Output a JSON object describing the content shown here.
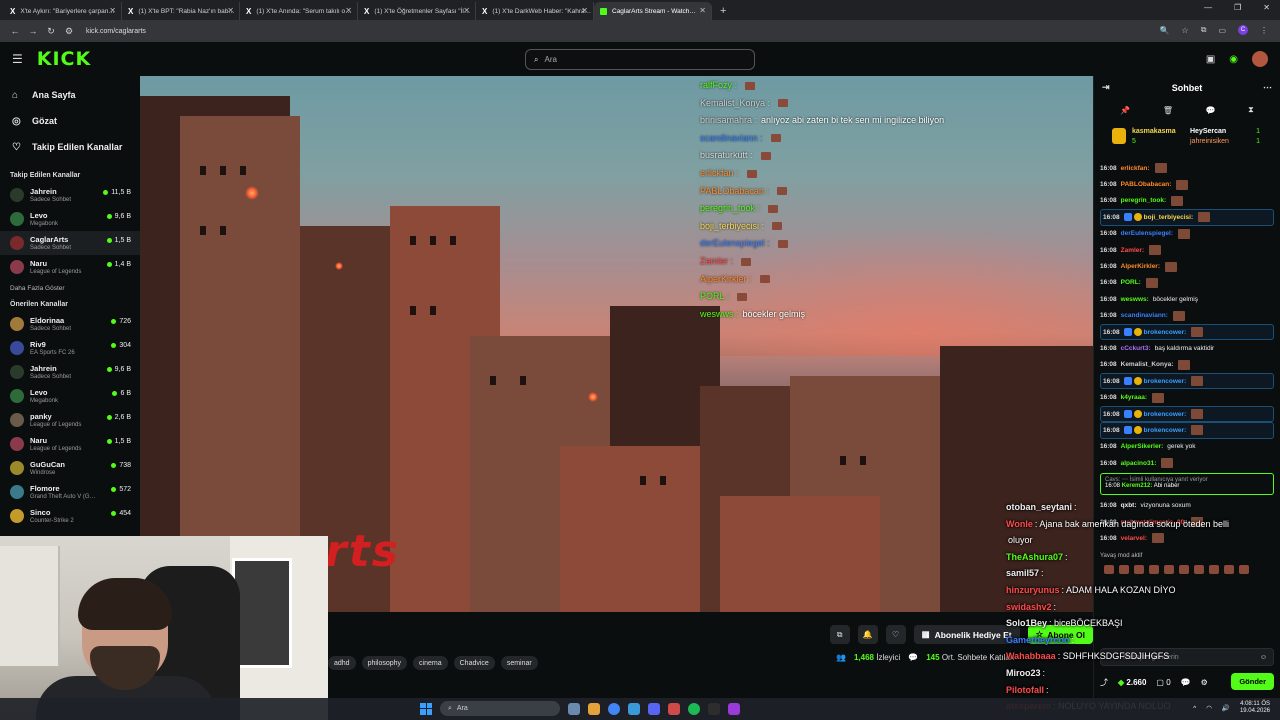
{
  "browser": {
    "tabs": [
      {
        "label": "X'te Aykırı: \"Bariyerlere çarpan…"
      },
      {
        "label": "(1) X'te BPT: \"Rabia Naz'ın bab…"
      },
      {
        "label": "(1) X'te Anında: \"Serum takılı o…"
      },
      {
        "label": "(1) X'te Öğretmenler Sayfası \"İl…"
      },
      {
        "label": "(1) X'te DarkWeb Haber: \"Kahra…"
      },
      {
        "label": "CaglarArts Stream - Watch…"
      }
    ],
    "url": "kick.com/caglararts"
  },
  "header": {
    "logo": "KICK",
    "search_placeholder": "Ara"
  },
  "sidebar": {
    "nav": [
      {
        "label": "Ana Sayfa",
        "icon": "home-icon"
      },
      {
        "label": "Gözat",
        "icon": "compass-icon"
      },
      {
        "label": "Takip Edilen Kanallar",
        "icon": "heart-icon"
      }
    ],
    "followed_title": "Takip Edilen Kanallar",
    "followed": [
      {
        "name": "Jahrein",
        "category": "Sadece Sohbet",
        "viewers": "11,5 B",
        "color": "#2b3b2b"
      },
      {
        "name": "Levo",
        "category": "Megabonk",
        "viewers": "9,6 B",
        "color": "#2d6b3a"
      },
      {
        "name": "CaglarArts",
        "category": "Sadece Sohbet",
        "viewers": "1,5 B",
        "color": "#7a2a2a"
      },
      {
        "name": "Naru",
        "category": "League of Legends",
        "viewers": "1,4 B",
        "color": "#8a3a4a"
      }
    ],
    "show_more": "Daha Fazla Göster",
    "recommended_title": "Önerilen Kanallar",
    "recommended": [
      {
        "name": "Eldorinaa",
        "category": "Sadece Sohbet",
        "viewers": "726",
        "color": "#a07a3a"
      },
      {
        "name": "Riv9",
        "category": "EA Sports FC 26",
        "viewers": "304",
        "color": "#3a4a9a"
      },
      {
        "name": "Jahrein",
        "category": "Sadece Sohbet",
        "viewers": "9,6 B",
        "color": "#2b3b2b"
      },
      {
        "name": "Levo",
        "category": "Megabonk",
        "viewers": "6 B",
        "color": "#2d6b3a"
      },
      {
        "name": "panky",
        "category": "League of Legends",
        "viewers": "2,6 B",
        "color": "#6a5a4a"
      },
      {
        "name": "Naru",
        "category": "League of Legends",
        "viewers": "1,5 B",
        "color": "#8a3a4a"
      },
      {
        "name": "GuGuCan",
        "category": "Windrose",
        "viewers": "738",
        "color": "#9a8a2a"
      },
      {
        "name": "Flomore",
        "category": "Grand Theft Auto V (G…",
        "viewers": "572",
        "color": "#3a7a8a"
      },
      {
        "name": "Sinco",
        "category": "Counter-Strike 2",
        "viewers": "454",
        "color": "#c49a2a"
      }
    ]
  },
  "video_overlay_chat": [
    {
      "user": "ralfFozy :",
      "text": "",
      "color": "#53fc18"
    },
    {
      "user": "Kemalist_Konya :",
      "text": "",
      "color": "#cfcfcf"
    },
    {
      "user": "brinisamahra :",
      "text": "anlıyoz abi zaten bi tek sen mi ingilizce biliyon",
      "color": "#cfcfcf"
    },
    {
      "user": "scandinaviann :",
      "text": "",
      "color": "#3a7fff"
    },
    {
      "user": "busraturkutt :",
      "text": "",
      "color": "#d9d9d9"
    },
    {
      "user": "erlickfan :",
      "text": "",
      "color": "#ff8a2a"
    },
    {
      "user": "PABLObabacan :",
      "text": "",
      "color": "#ff8a2a"
    },
    {
      "user": "peregrin_took :",
      "text": "",
      "color": "#53fc18"
    },
    {
      "user": "boji_terbiyecisi :",
      "text": "",
      "color": "#f5d94d"
    },
    {
      "user": "derEulenspiegel :",
      "text": "",
      "color": "#3a7fff"
    },
    {
      "user": "Zamler :",
      "text": "",
      "color": "#ff4a4a"
    },
    {
      "user": "AlperKirkler :",
      "text": "",
      "color": "#ff8a2a"
    },
    {
      "user": "PORL :",
      "text": "",
      "color": "#53fc18"
    },
    {
      "user": "weswws :",
      "text": "böcekler gelmiş",
      "color": "#53fc18"
    }
  ],
  "video_watermark": "rts",
  "stream_bar": {
    "gift_label": "Abonelik Hediye Et",
    "follow_label": "Abone Ol",
    "tags": [
      "adhd",
      "philosophy",
      "cinema",
      "Chadvice",
      "seminar"
    ],
    "viewers": "1,468",
    "viewers_label": "İzleyici",
    "chatters": "145",
    "chatters_label": "Ort. Sohbete Katılan"
  },
  "chat": {
    "title": "Sohbet",
    "pinned": {
      "user1": "kasmakasma",
      "user1_count": "5",
      "user2": "HeySercan",
      "user2_count": "1",
      "user3": "jahreinisiken",
      "user3_count": "1"
    },
    "messages": [
      {
        "time": "16:08",
        "user": "erlickfan:",
        "text": "",
        "color": "#ff8a2a",
        "hl": false
      },
      {
        "time": "16:08",
        "user": "PABLObabacan:",
        "text": "",
        "color": "#ff8a2a",
        "hl": false
      },
      {
        "time": "16:08",
        "user": "peregrin_took:",
        "text": "",
        "color": "#53fc18",
        "hl": false
      },
      {
        "time": "16:08",
        "user": "boji_terbiyecisi:",
        "text": "",
        "color": "#f5d94d",
        "hl": true
      },
      {
        "time": "16:08",
        "user": "derEulenspiegel:",
        "text": "",
        "color": "#3a7fff",
        "hl": false
      },
      {
        "time": "16:08",
        "user": "Zamler:",
        "text": "",
        "color": "#ff4a4a",
        "hl": false
      },
      {
        "time": "16:08",
        "user": "AlperKirkler:",
        "text": "",
        "color": "#ff8a2a",
        "hl": false
      },
      {
        "time": "16:08",
        "user": "PORL:",
        "text": "",
        "color": "#53fc18",
        "hl": false
      },
      {
        "time": "16:08",
        "user": "weswws:",
        "text": "böcekler gelmiş",
        "color": "#53fc18",
        "hl": false
      },
      {
        "time": "16:08",
        "user": "scandinaviann:",
        "text": "",
        "color": "#3a7fff",
        "hl": false
      },
      {
        "time": "16:08",
        "user": "brokencower:",
        "text": "",
        "color": "#3a9fff",
        "hl": true
      },
      {
        "time": "16:08",
        "user": "cCckurt3:",
        "text": "baş kaldırma vaktidir",
        "color": "#b070ff",
        "hl": false
      },
      {
        "time": "16:08",
        "user": "Kemalist_Konya:",
        "text": "",
        "color": "#cfcfcf",
        "hl": false
      },
      {
        "time": "16:08",
        "user": "brokencower:",
        "text": "",
        "color": "#3a9fff",
        "hl": true
      },
      {
        "time": "16:08",
        "user": "k4yraaa:",
        "text": "",
        "color": "#53fc18",
        "hl": false
      },
      {
        "time": "16:08",
        "user": "brokencower:",
        "text": "",
        "color": "#3a9fff",
        "hl": true
      },
      {
        "time": "16:08",
        "user": "brokencower:",
        "text": "",
        "color": "#3a9fff",
        "hl": true
      },
      {
        "time": "16:08",
        "user": "AlperSikerler:",
        "text": "gerek yok",
        "color": "#53fc18",
        "hl": false
      },
      {
        "time": "16:08",
        "user": "alpacino31:",
        "text": "",
        "color": "#53fc18",
        "hl": false
      }
    ],
    "reply": {
      "top": "Cavs: ⋯ İsimli kullanıcıya yanıt veriyor",
      "time": "16:08",
      "user": "Kerem212:",
      "text": "Abi naber"
    },
    "after_reply": [
      {
        "time": "16:08",
        "user": "qxbt:",
        "text": "vizyonuna soxum",
        "color": "#eee"
      },
      {
        "time": "16:08",
        "user": "mehmetalimemis_00:",
        "text": "",
        "color": "#ff4a4a"
      },
      {
        "time": "16:08",
        "user": "velarvel:",
        "text": "",
        "color": "#ff4a4a"
      }
    ],
    "slow_mode": "Yavaş mod aktif",
    "input_placeholder": "Mesajını gönderin",
    "points": "2.660",
    "points_count": "0",
    "send_label": "Gönder"
  },
  "big_chat": [
    {
      "user": "otoban_seytani",
      "text": ":",
      "color": "#eee"
    },
    {
      "user": "Wonle",
      "text": ": Ajana bak amerikan dağında sokup öteden belli",
      "color": "#ff4a4a"
    },
    {
      "user": "",
      "text": "oluyor",
      "color": "#eee"
    },
    {
      "user": "TheAshura07",
      "text": ":",
      "color": "#53fc18"
    },
    {
      "user": "samil57",
      "text": ":",
      "color": "#eee"
    },
    {
      "user": "hinzuryunus",
      "text": ": ADAM HALA KOZAN DİYO",
      "color": "#ff4a4a"
    },
    {
      "user": "swidashv2",
      "text": ":",
      "color": "#ff4a4a"
    },
    {
      "user": "Solo1Bey",
      "text": ": biceBÖCEKBAŞI",
      "color": "#eee"
    },
    {
      "user": "Gamerbeyrcoo",
      "text": ":",
      "color": "#3a7fff"
    },
    {
      "user": "Wahabbaaa",
      "text": ": SDHFHKSDGFSDJIHGFS",
      "color": "#ff4a4a"
    },
    {
      "user": "Miroo23",
      "text": ":",
      "color": "#eee"
    },
    {
      "user": "Pilotofall",
      "text": ":",
      "color": "#ff4a4a"
    },
    {
      "user": "atesparem",
      "text": ": NOLUYO YAYINDA NOLUO",
      "color": "#ff4a4a"
    }
  ],
  "taskbar": {
    "search": "Ara",
    "time": "4:08:11 ÖS",
    "date": "19.04.2026"
  }
}
